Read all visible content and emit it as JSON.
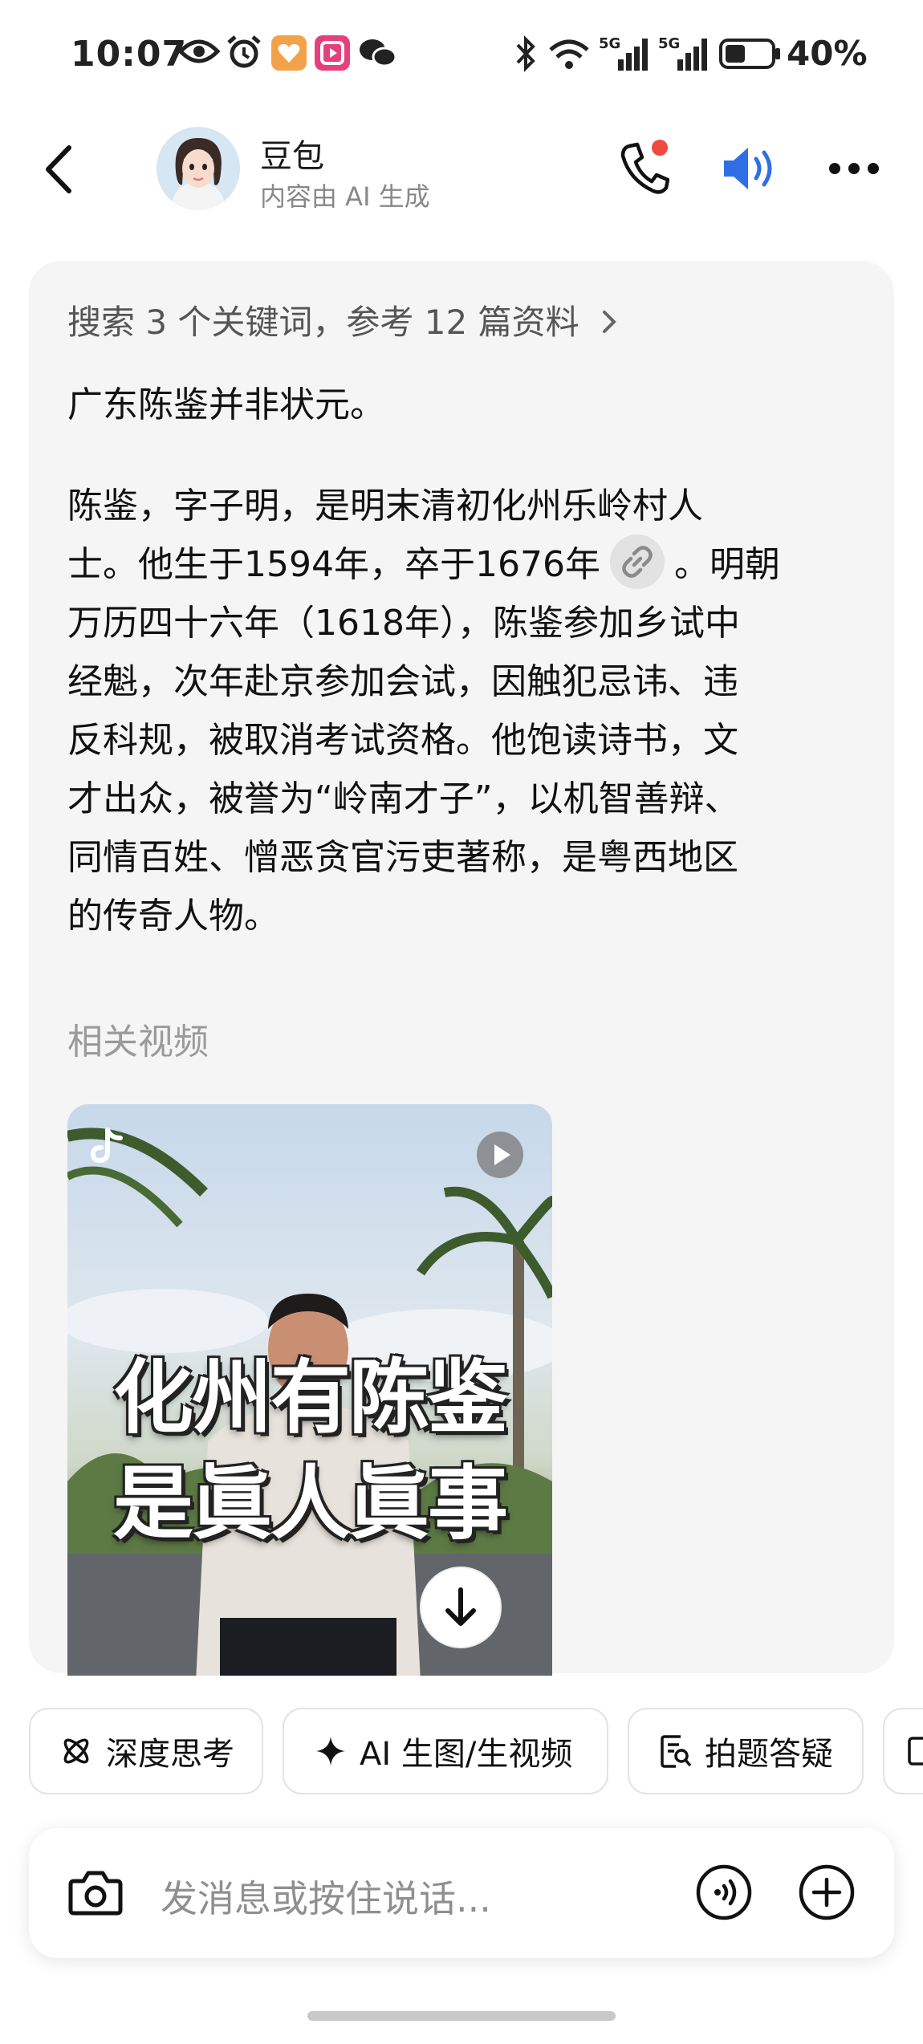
{
  "status_bar": {
    "time": "10:07",
    "battery": "40%",
    "icons": [
      "eye-icon",
      "alarm-icon",
      "app-heart-icon",
      "app-video-icon",
      "wechat-icon",
      "bluetooth-icon",
      "wifi-icon",
      "signal-5g-icon",
      "signal-5g-icon",
      "battery-icon"
    ]
  },
  "header": {
    "bot_name": "豆包",
    "bot_subtitle": "内容由 AI 生成",
    "icons": {
      "back": "back-arrow-icon",
      "call": "phone-icon",
      "speaker": "speaker-icon",
      "more": "more-icon"
    },
    "call_badge_color": "#f04a3e",
    "speaker_color": "#2f6ee6"
  },
  "message": {
    "search_summary": "搜索 3 个关键词，参考 12 篇资料",
    "lead": "广东陈鉴并非状元。",
    "body_lines": [
      "陈鉴，字子明，是明末清初化州乐岭村人",
      "士。他生于1594年，卒于1676年",
      "。明朝",
      "万历四十六年（1618年），陈鉴参加乡试中",
      "经魁，次年赴京参加会试，因触犯忌讳、违",
      "反科规，被取消考试资格。他饱读诗书，文",
      "才出众，被誉为“岭南才子”，以机智善辩、",
      "同情百姓、憎恶贪官污吏著称，是粤西地区",
      "的传奇人物。"
    ],
    "related_title": "相关视频",
    "video": {
      "caption_line1": "化州有陈鉴",
      "caption_line2": "是眞人眞事"
    }
  },
  "chips": [
    "深度思考",
    "AI 生图/生视频",
    "拍题答疑"
  ],
  "input": {
    "placeholder": "发消息或按住说话..."
  }
}
